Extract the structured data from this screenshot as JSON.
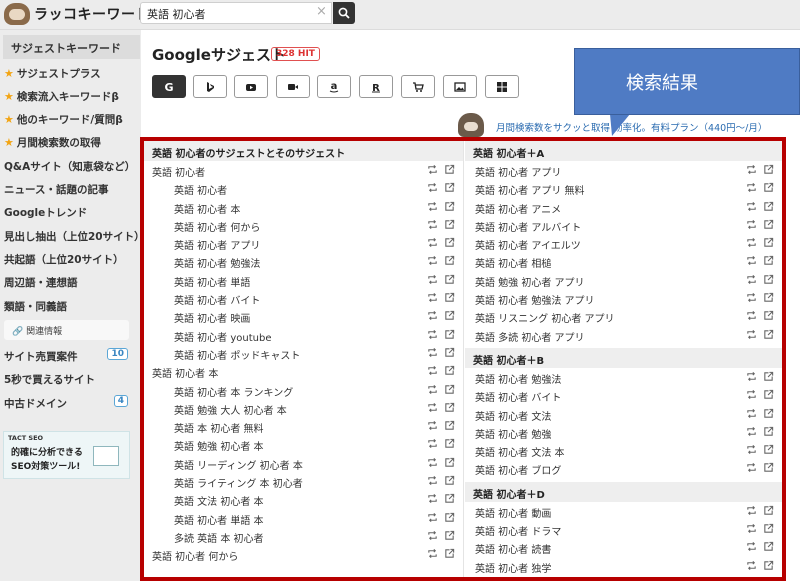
{
  "app": {
    "logo_text": "ラッコキーワード"
  },
  "search": {
    "value": "英語 初心者"
  },
  "sidebar": {
    "heading": "サジェストキーワード",
    "items": [
      {
        "label": "サジェストプラス",
        "star": true
      },
      {
        "label": "検索流入キーワードβ",
        "star": true
      },
      {
        "label": "他のキーワード/質問β",
        "star": true
      },
      {
        "label": "月間検索数の取得",
        "star": true
      },
      {
        "label": "Q&Aサイト（知恵袋など）",
        "star": false
      },
      {
        "label": "ニュース・話題の記事",
        "star": false
      },
      {
        "label": "Googleトレンド",
        "star": false
      },
      {
        "label": "見出し抽出（上位20サイト）",
        "star": false
      },
      {
        "label": "共起語（上位20サイト）",
        "star": false
      },
      {
        "label": "周辺語・連想語",
        "star": false
      },
      {
        "label": "類語・同義語",
        "star": false
      }
    ],
    "related_label": "関連情報",
    "related_items": [
      {
        "label": "サイト売買案件",
        "badge": "10"
      },
      {
        "label": "5秒で買えるサイト",
        "badge": ""
      },
      {
        "label": "中古ドメイン",
        "badge": "4"
      }
    ],
    "banner": {
      "brand": "TACT SEO",
      "line1": "的確に分析できる",
      "line2": "SEO対策ツール!"
    }
  },
  "main": {
    "title": "Googleサジェスト",
    "hit_badge": "328 HIT",
    "callout": "検索結果",
    "promo": "月間検索数をサクッと取得 効率化。有料プラン（440円〜/月）",
    "left_column": {
      "heading": "英語 初心者のサジェストとそのサジェスト",
      "rows": [
        {
          "text": "英語 初心者",
          "level": 0
        },
        {
          "text": "英語 初心者",
          "level": 1
        },
        {
          "text": "英語 初心者 本",
          "level": 1
        },
        {
          "text": "英語 初心者 何から",
          "level": 1
        },
        {
          "text": "英語 初心者 アプリ",
          "level": 1
        },
        {
          "text": "英語 初心者 勉強法",
          "level": 1
        },
        {
          "text": "英語 初心者 単語",
          "level": 1
        },
        {
          "text": "英語 初心者 バイト",
          "level": 1
        },
        {
          "text": "英語 初心者 映画",
          "level": 1
        },
        {
          "text": "英語 初心者 youtube",
          "level": 1
        },
        {
          "text": "英語 初心者 ポッドキャスト",
          "level": 1
        },
        {
          "text": "英語 初心者 本",
          "level": 0
        },
        {
          "text": "英語 初心者 本 ランキング",
          "level": 1
        },
        {
          "text": "英語 勉強 大人 初心者 本",
          "level": 1
        },
        {
          "text": "英語 本 初心者 無料",
          "level": 1
        },
        {
          "text": "英語 勉強 初心者 本",
          "level": 1
        },
        {
          "text": "英語 リーディング 初心者 本",
          "level": 1
        },
        {
          "text": "英語 ライティング 本 初心者",
          "level": 1
        },
        {
          "text": "英語 文法 初心者 本",
          "level": 1
        },
        {
          "text": "英語 初心者 単語 本",
          "level": 1
        },
        {
          "text": "多読 英語 本 初心者",
          "level": 1
        },
        {
          "text": "英語 初心者 何から",
          "level": 0
        }
      ]
    },
    "right_sections": [
      {
        "heading": "英語 初心者＋A",
        "rows": [
          "英語 初心者 アプリ",
          "英語 初心者 アプリ 無料",
          "英語 初心者 アニメ",
          "英語 初心者 アルバイト",
          "英語 初心者 アイエルツ",
          "英語 初心者 相槌",
          "英語 勉強 初心者 アプリ",
          "英語 初心者 勉強法 アプリ",
          "英語 リスニング 初心者 アプリ",
          "英語 多読 初心者 アプリ"
        ]
      },
      {
        "heading": "英語 初心者＋B",
        "rows": [
          "英語 初心者 勉強法",
          "英語 初心者 バイト",
          "英語 初心者 文法",
          "英語 初心者 勉強",
          "英語 初心者 文法 本",
          "英語 初心者 ブログ"
        ]
      },
      {
        "heading": "英語 初心者＋D",
        "rows": [
          "英語 初心者 動画",
          "英語 初心者 ドラマ",
          "英語 初心者 読書",
          "英語 初心者 独学"
        ]
      }
    ]
  }
}
